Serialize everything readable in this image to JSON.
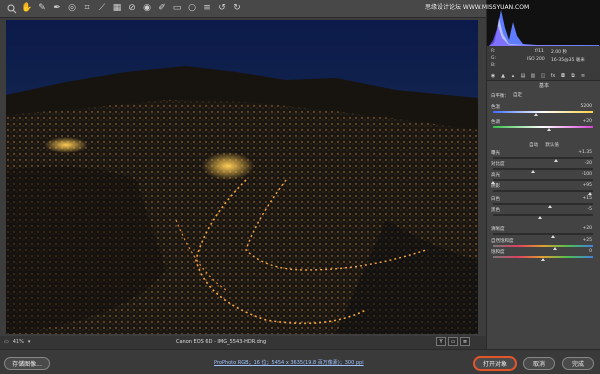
{
  "watermark": "思缘设计论坛 WWW.MISSYUAN.COM",
  "toolbar": {
    "tools": [
      "zoom-tool",
      "hand-tool",
      "white-balance-tool",
      "color-sampler-tool",
      "targeted-adjustment-tool",
      "crop-tool",
      "straighten-tool",
      "transform-tool",
      "spot-removal-tool",
      "red-eye-tool",
      "adjustment-brush",
      "graduated-filter",
      "radial-filter",
      "preferences",
      "rotate-left",
      "rotate-right"
    ]
  },
  "status": {
    "zoom": "41%",
    "filename": "Canon EOS 6D  -  IMG_5543-HDR.dng"
  },
  "view_toggles": [
    "Y",
    "▭",
    "≡"
  ],
  "bottom": {
    "save_label": "存储图像...",
    "workflow": "ProPhoto RGB；16 位；5454 x 3635(19.8 百万像素)；300 ppi",
    "open_label": "打开对象",
    "cancel_label": "取消",
    "done_label": "完成"
  },
  "exif": {
    "r": "R:",
    "g": "G:",
    "b": "B:",
    "shutter": "f/11",
    "shutter2": "2.00 秒",
    "iso": "ISO 200",
    "lens": "16-35@35 毫米"
  },
  "panel": {
    "section": "基本",
    "wb_label": "白平衡：",
    "wb_value": "自定",
    "auto": "自动",
    "default": "默认值"
  },
  "sliders": [
    {
      "label": "色温",
      "value": "5200",
      "pos": 0.43
    },
    {
      "label": "色调",
      "value": "+20",
      "pos": 0.56
    },
    {
      "label": "曝光",
      "value": "+1.35",
      "pos": 0.63
    },
    {
      "label": "对比度",
      "value": "-20",
      "pos": 0.4
    },
    {
      "label": "高光",
      "value": "-100",
      "pos": 0.0
    },
    {
      "label": "阴影",
      "value": "+95",
      "pos": 0.97
    },
    {
      "label": "白色",
      "value": "+15",
      "pos": 0.57
    },
    {
      "label": "黑色",
      "value": "-5",
      "pos": 0.47
    },
    {
      "label": "清晰度",
      "value": "+20",
      "pos": 0.6
    },
    {
      "label": "自然饱和度",
      "value": "+25",
      "pos": 0.62
    },
    {
      "label": "饱和度",
      "value": "0",
      "pos": 0.5
    }
  ],
  "colors": {
    "accent_highlight": "#e3562a",
    "link": "#9ec1ff"
  }
}
